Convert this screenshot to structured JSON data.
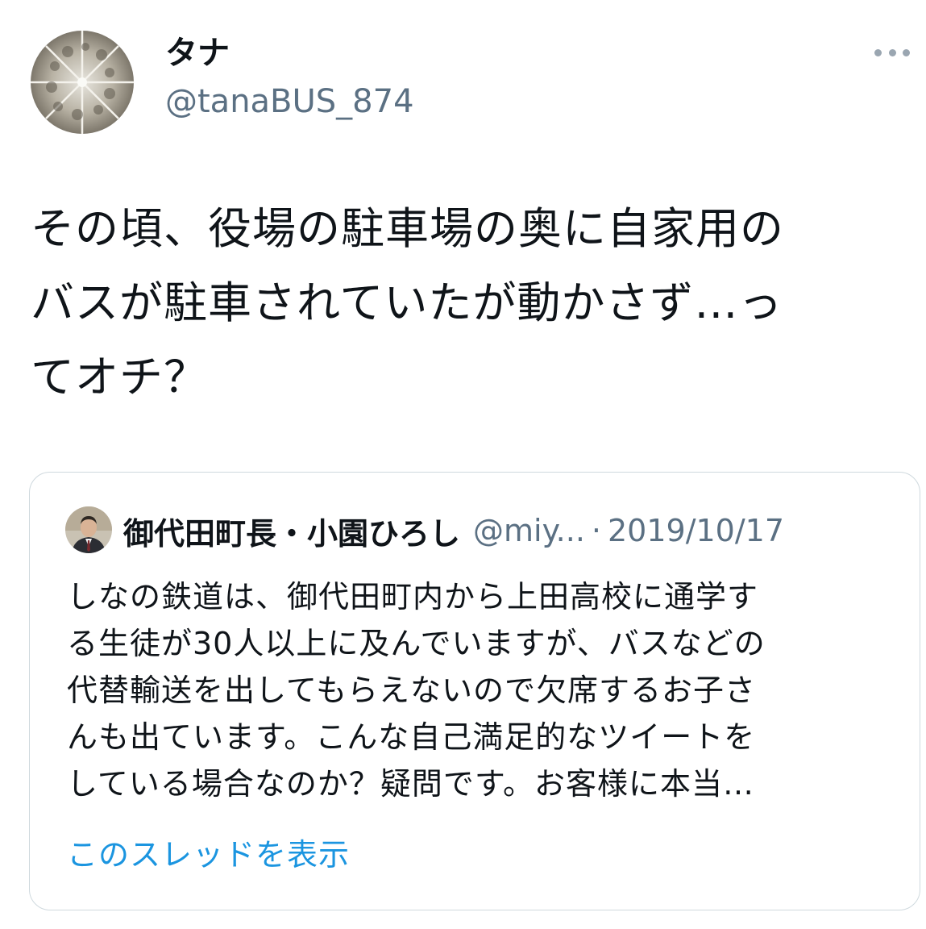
{
  "tweet": {
    "author_name": "タナ",
    "author_handle": "@tanaBUS_874",
    "more_icon": "more-horizontal-icon",
    "body_lines": [
      "その頃、役場の駐車場の奥に自家用の",
      "バスが駐車されていたが動かさず…っ",
      "てオチ？"
    ]
  },
  "quoted_tweet": {
    "author_name": "御代田町長・小園ひろし",
    "author_handle": "@miy...",
    "separator": "·",
    "date": "2019/10/17",
    "body_lines": [
      "しなの鉄道は、御代田町内から上田高校に通学す",
      "る生徒が30人以上に及んでいますが、バスなどの",
      "代替輸送を出してもらえないので欠席するお子さ",
      "んも出ています。こんな自己満足的なツイートを",
      "している場合なのか？疑問です。お客様に本当…"
    ],
    "show_thread": "このスレッドを表示"
  },
  "colors": {
    "text_primary": "#0f1419",
    "text_secondary": "#5b7083",
    "link": "#1b95e0",
    "border": "#cfd9de"
  }
}
